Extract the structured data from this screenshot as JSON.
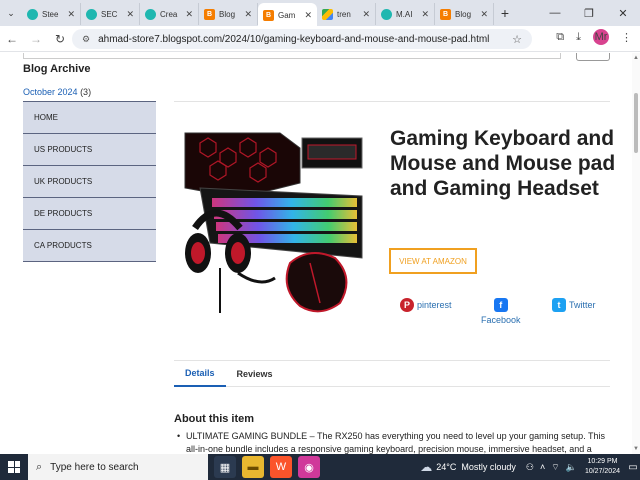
{
  "browser": {
    "tabs": [
      {
        "label": "Stee",
        "icon": "teal"
      },
      {
        "label": "SEC",
        "icon": "teal"
      },
      {
        "label": "Crea",
        "icon": "teal"
      },
      {
        "label": "Blog",
        "icon": "blogger"
      },
      {
        "label": "Gam",
        "icon": "blogger",
        "active": true
      },
      {
        "label": "tren",
        "icon": "drive"
      },
      {
        "label": "M.AI",
        "icon": "teal"
      },
      {
        "label": "Blog",
        "icon": "blogger"
      }
    ],
    "url": "ahmad-store7.blogspot.com/2024/10/gaming-keyboard-and-mouse-and-mouse-pad.html",
    "profile_initials": "Mr"
  },
  "sidebar": {
    "archive_title": "Blog Archive",
    "archive_month": "October 2024",
    "archive_count": "(3)",
    "menu": [
      "HOME",
      "US PRODUCTS",
      "UK PRODUCTS",
      "DE PRODUCTS",
      "CA PRODUCTS"
    ]
  },
  "product": {
    "title": "Gaming Keyboard and Mouse and Mouse pad and Gaming Headset",
    "amazon_button": "VIEW AT AMAZON",
    "share": {
      "pinterest": "pinterest",
      "facebook": "Facebook",
      "twitter": "Twitter"
    },
    "tabs": [
      "Details",
      "Reviews"
    ],
    "about_title": "About this item",
    "about_text": "ULTIMATE GAMING BUNDLE – The RX250 has everything you need to level up your gaming setup. This all-in-one bundle includes a responsive gaming keyboard, precision mouse, immersive headset, and a durable"
  },
  "taskbar": {
    "search_placeholder": "Type here to search",
    "weather_temp": "24°C",
    "weather_text": "Mostly cloudy",
    "time": "10:29 PM",
    "date": "10/27/2024"
  }
}
